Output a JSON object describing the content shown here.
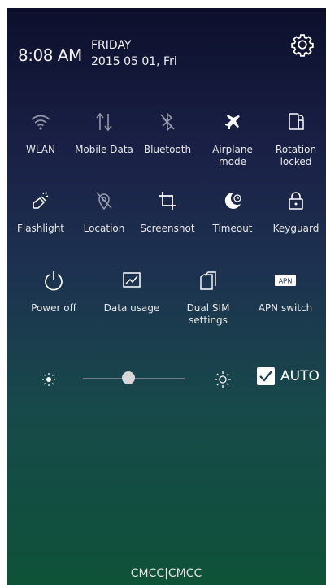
{
  "header": {
    "time": "8:08 AM",
    "day": "FRIDAY",
    "date": "2015 05 01, Fri"
  },
  "tiles_row1": [
    {
      "label": "WLAN",
      "icon": "wifi-icon"
    },
    {
      "label": "Mobile Data",
      "icon": "mobile-data-icon"
    },
    {
      "label": "Bluetooth",
      "icon": "bluetooth-icon"
    },
    {
      "label": "Airplane mode",
      "icon": "airplane-icon"
    },
    {
      "label": "Rotation locked",
      "icon": "rotation-lock-icon"
    }
  ],
  "tiles_row2": [
    {
      "label": "Flashlight",
      "icon": "flashlight-icon"
    },
    {
      "label": "Location",
      "icon": "location-icon"
    },
    {
      "label": "Screenshot",
      "icon": "crop-icon"
    },
    {
      "label": "Timeout",
      "icon": "timeout-icon"
    },
    {
      "label": "Keyguard",
      "icon": "lock-icon"
    }
  ],
  "tiles_row3": [
    {
      "label": "Power off",
      "icon": "power-icon"
    },
    {
      "label": "Data usage",
      "icon": "data-usage-icon"
    },
    {
      "label": "Dual SIM settings",
      "icon": "dual-sim-icon"
    },
    {
      "label": "APN switch",
      "icon": "apn-icon",
      "badge": "APN"
    }
  ],
  "brightness": {
    "level": 0.45,
    "auto_label": "AUTO",
    "auto_checked": true
  },
  "carrier": "CMCC|CMCC",
  "colors": {
    "gradient_top": "#0d0f2c",
    "gradient_bottom": "#0e5238",
    "text": "#ffffff"
  }
}
